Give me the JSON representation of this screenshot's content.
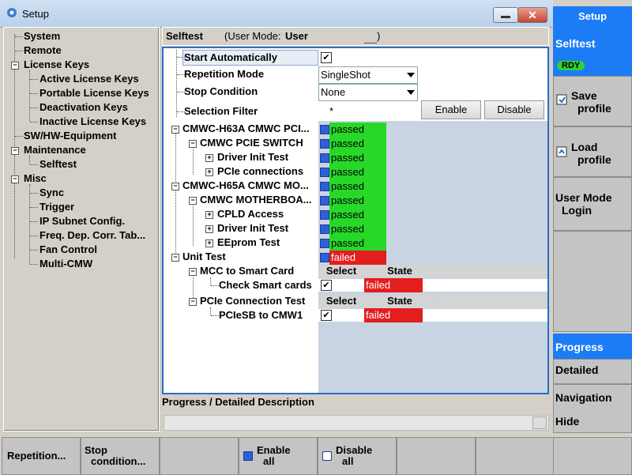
{
  "window": {
    "title": "Setup"
  },
  "tree": {
    "items": [
      {
        "label": "System"
      },
      {
        "label": "Remote"
      },
      {
        "label": "License Keys"
      },
      {
        "label": "Active License Keys"
      },
      {
        "label": "Portable License Keys"
      },
      {
        "label": "Deactivation Keys"
      },
      {
        "label": "Inactive License Keys"
      },
      {
        "label": "SW/HW-Equipment"
      },
      {
        "label": "Maintenance"
      },
      {
        "label": "Selftest"
      },
      {
        "label": "Misc"
      },
      {
        "label": "Sync"
      },
      {
        "label": "Trigger"
      },
      {
        "label": "IP Subnet Config."
      },
      {
        "label": "Freq. Dep. Corr. Tab..."
      },
      {
        "label": "Fan Control"
      },
      {
        "label": "Multi-CMW"
      }
    ]
  },
  "header": {
    "title": "Selftest",
    "user_mode_prefix": "(User Mode:",
    "user_mode_value": "User",
    "user_mode_suffix": ")"
  },
  "settings": {
    "start_auto_label": "Start Automatically",
    "start_auto_checked": "✔",
    "repetition_label": "Repetition Mode",
    "repetition_value": "SingleShot",
    "stop_label": "Stop Condition",
    "stop_value": "None",
    "filter_label": "Selection Filter",
    "filter_value": "*",
    "enable_label": "Enable",
    "disable_label": "Disable"
  },
  "tests": [
    {
      "label": "CMWC-H63A CMWC PCI...",
      "status": "passed"
    },
    {
      "label": "CMWC PCIE SWITCH",
      "status": "passed"
    },
    {
      "label": "Driver Init Test",
      "status": "passed"
    },
    {
      "label": "PCIe connections",
      "status": "passed"
    },
    {
      "label": "CMWC-H65A CMWC MO...",
      "status": "passed"
    },
    {
      "label": "CMWC MOTHERBOA...",
      "status": "passed"
    },
    {
      "label": "CPLD Access",
      "status": "passed"
    },
    {
      "label": "Driver Init Test",
      "status": "passed"
    },
    {
      "label": "EEprom Test",
      "status": "passed"
    },
    {
      "label": "Unit Test",
      "status": "failed"
    }
  ],
  "unit_tests": {
    "mcc_label": "MCC to Smart Card",
    "select_header": "Select",
    "state_header": "State",
    "check_cards_label": "Check Smart cards",
    "check_cards_state": "failed",
    "pcie_label": "PCIe Connection Test",
    "pciesb_label": "PCIeSB to CMW1",
    "pciesb_state": "failed",
    "check_mark": "✔"
  },
  "progress": {
    "title": "Progress / Detailed Description"
  },
  "softkeys_right": {
    "setup": "Setup",
    "selftest": "Selftest",
    "rdy": "RDY",
    "save_line1": "Save",
    "save_line2": "profile",
    "load_line1": "Load",
    "load_line2": "profile",
    "usermode_line1": "User Mode",
    "usermode_line2": "Login",
    "progress": "Progress",
    "detailed": "Detailed",
    "navigation": "Navigation",
    "hide": "Hide"
  },
  "softkeys_bottom": {
    "repetition": "Repetition...",
    "stop_line1": "Stop",
    "stop_line2": "condition...",
    "enable_line1": "Enable",
    "enable_line2": "all",
    "disable_line1": "Disable",
    "disable_line2": "all"
  },
  "colors": {
    "passed": "#28d828",
    "failed": "#e41d1d",
    "accent": "#2a6ecd",
    "softkey_active": "#1c7cf5"
  }
}
